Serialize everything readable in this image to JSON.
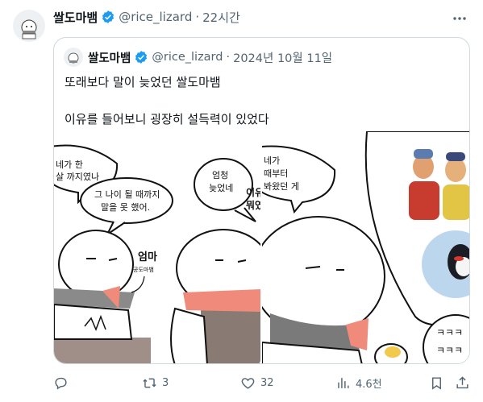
{
  "tweet": {
    "author_name": "쌀도마뱀",
    "handle": "@rice_lizard",
    "separator": "·",
    "time": "22시간"
  },
  "quote": {
    "author_name": "쌀도마뱀",
    "handle": "@rice_lizard",
    "separator": "·",
    "date": "2024년 10월 11일",
    "text_line1": "또래보다 말이 늦었던 쌀도마뱀",
    "text_line2": "이유를 들어보니 굉장히 설득력이 있었다"
  },
  "comic": {
    "panel1": {
      "bubble1_line1": "네가 한",
      "bubble1_line2": "살 까지였나",
      "bubble2_line1": "그 나이 될 때까지",
      "bubble2_line2": "말을 못 했어.",
      "bubble3_line1": "엄청",
      "bubble3_line2": "늦었네",
      "bubble4_line1": "이유",
      "bubble4_line2": "뭐였",
      "mom_label": "엄마",
      "mom_sub": "공도마뱀"
    },
    "panel2": {
      "bubble1_line1": "네가",
      "bubble1_line2": "때부터",
      "bubble1_line3": "봐왔던 게",
      "laugh_line1": "ㅋㅋㅋ",
      "laugh_line2": "ㅋㅋㅋ"
    }
  },
  "actions": {
    "reply_count": "",
    "retweet_count": "3",
    "like_count": "32",
    "views_count": "4.6천"
  },
  "colors": {
    "verified": "#1d9bf0",
    "muted": "#536471",
    "border": "#cfd9de",
    "scarf": "#f08a7a",
    "knit": "#7a7a7a"
  }
}
